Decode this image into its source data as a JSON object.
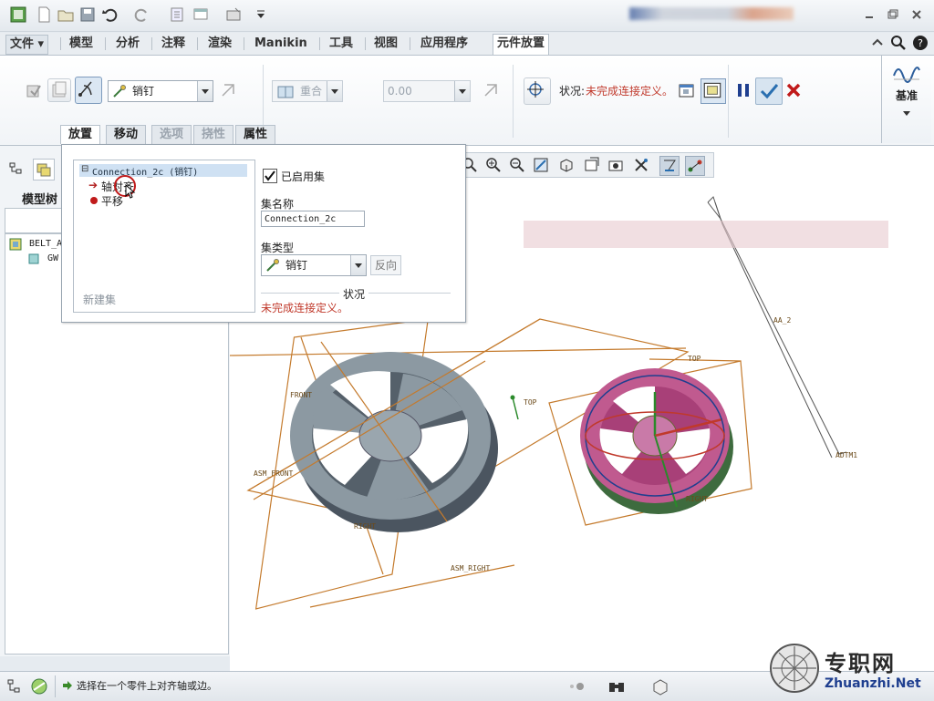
{
  "tabs": {
    "file": "文件",
    "items": [
      "模型",
      "分析",
      "注释",
      "渲染",
      "Manikin",
      "工具",
      "视图",
      "应用程序",
      "元件放置"
    ]
  },
  "ribbon": {
    "constraint_type": "销钉",
    "offset_type": "重合",
    "offset_value": "0.00",
    "status_label": "状况:",
    "status_value": "未完成连接定义。",
    "datum_label": "基准"
  },
  "subtabs": [
    "放置",
    "移动",
    "选项",
    "挠性",
    "属性"
  ],
  "placement_panel": {
    "connection_title": "Connection_2c (销钉)",
    "constraint_axis": "轴对齐",
    "constraint_translate": "平移",
    "new_set": "新建集",
    "enabled_set_label": "已启用集",
    "enabled_set_checked": true,
    "set_name_label": "集名称",
    "set_name_value": "Connection_2c",
    "set_type_label": "集类型",
    "set_type_value": "销钉",
    "flip_button": "反向",
    "status_header": "状况",
    "status_message": "未完成连接定义。"
  },
  "left_pane": {
    "model_tree_label": "模型树",
    "tree_items": [
      "BELT_A",
      "GW"
    ]
  },
  "model_labels": {
    "front": "FRONT",
    "asm_front": "ASM_FRONT",
    "right": "RIGHT",
    "asm_right": "ASM_RIGHT",
    "top": "TOP",
    "top2": "TOP",
    "right2": "RIGHT",
    "aa2": "AA_2",
    "adtm1": "ADTM1"
  },
  "status_bar": {
    "message": "选择在一个零件上对齐轴或边。"
  },
  "watermark": {
    "cn": "专职网",
    "en": "Zhuanzhi.Net"
  },
  "colors": {
    "status_orange": "#c0392b",
    "accent_blue": "#3a7bd5",
    "datum_orange": "#c47a2c",
    "gear_gray": "#8c99a2",
    "gear_pink": "#c05a8f"
  }
}
